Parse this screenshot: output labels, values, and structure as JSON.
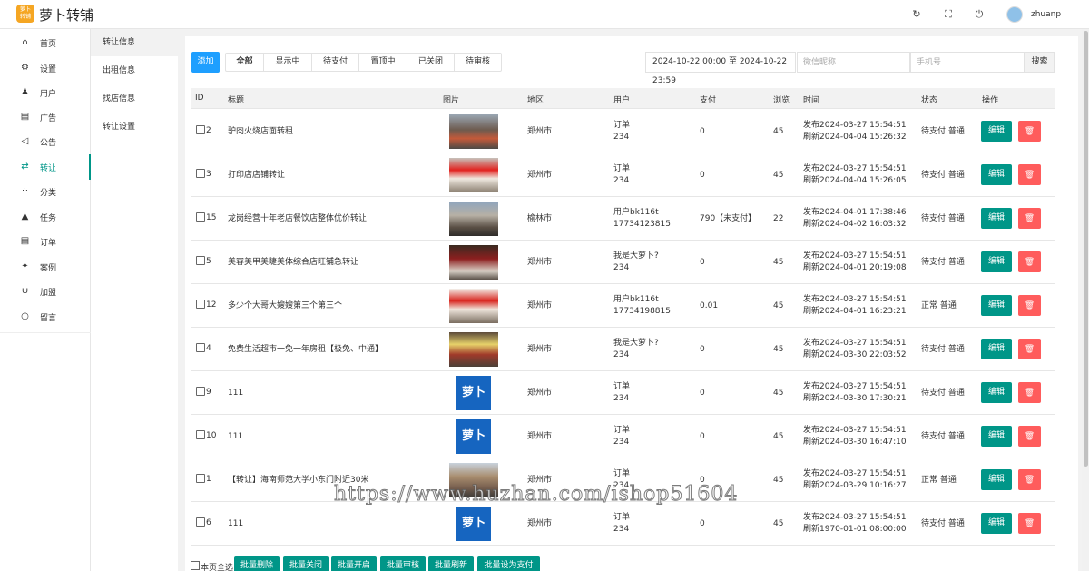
{
  "app": {
    "logo_text": "萝卜转铺",
    "title": "萝卜转铺"
  },
  "header": {
    "icons": [
      "refresh-icon",
      "fullscreen-icon",
      "power-icon"
    ],
    "username": "zhuanp"
  },
  "sidebar": {
    "items": [
      {
        "label": "首页",
        "icon": "home-icon"
      },
      {
        "label": "设置",
        "icon": "gear-icon"
      },
      {
        "label": "用户",
        "icon": "user-icon"
      },
      {
        "label": "广告",
        "icon": "document-icon"
      },
      {
        "label": "公告",
        "icon": "speaker-icon"
      },
      {
        "label": "转让",
        "icon": "shuffle-icon"
      },
      {
        "label": "分类",
        "icon": "category-icon"
      },
      {
        "label": "任务",
        "icon": "bell-icon"
      },
      {
        "label": "订单",
        "icon": "document-icon"
      },
      {
        "label": "案例",
        "icon": "medal-icon"
      },
      {
        "label": "加盟",
        "icon": "handshake-icon"
      },
      {
        "label": "留言",
        "icon": "chat-icon"
      }
    ],
    "active": "转让"
  },
  "subnav": {
    "items": [
      "转让信息",
      "出租信息",
      "找店信息",
      "转让设置"
    ],
    "active": "转让信息"
  },
  "toolbar": {
    "add_label": "添加",
    "filter_tabs": [
      "全部",
      "显示中",
      "待支付",
      "置顶中",
      "已关闭",
      "待审核"
    ],
    "active_tab": "全部",
    "date_range": "2024-10-22 00:00 至 2024-10-22 23:59",
    "nickname_placeholder": "微信昵称",
    "phone_placeholder": "手机号",
    "search_label": "搜索"
  },
  "table": {
    "columns": [
      "ID",
      "标题",
      "图片",
      "地区",
      "用户",
      "支付",
      "浏览",
      "时间",
      "状态",
      "操作"
    ],
    "edit_label": "编辑",
    "rows": [
      {
        "id": "2",
        "title": "驴肉火烧店面转租",
        "image": "photo",
        "region": "郑州市",
        "user1": "订单",
        "user2": "234",
        "pay": "0",
        "views": "45",
        "time1": "发布2024-03-27 15:54:51",
        "time2": "刷新2024-04-04 15:26:32",
        "status": "待支付 普通"
      },
      {
        "id": "3",
        "title": "打印店店铺转让",
        "image": "photo2",
        "region": "郑州市",
        "user1": "订单",
        "user2": "234",
        "pay": "0",
        "views": "45",
        "time1": "发布2024-03-27 15:54:51",
        "time2": "刷新2024-04-04 15:26:05",
        "status": "待支付 普通"
      },
      {
        "id": "15",
        "title": "龙岗经营十年老店餐饮店整体优价转让",
        "image": "photo3",
        "region": "榆林市",
        "user1": "用户bk116t",
        "user2": "17734123815",
        "pay": "790【未支付】",
        "views": "22",
        "time1": "发布2024-04-01 17:38:46",
        "time2": "刷新2024-04-02 16:03:32",
        "status": "待支付 普通"
      },
      {
        "id": "5",
        "title": "美容美甲美睫美体综合店旺铺急转让",
        "image": "photo4",
        "region": "郑州市",
        "user1": "我是大萝卜?",
        "user2": "234",
        "pay": "0",
        "views": "45",
        "time1": "发布2024-03-27 15:54:51",
        "time2": "刷新2024-04-01 20:19:08",
        "status": "待支付 普通"
      },
      {
        "id": "12",
        "title": "多少个大哥大嫂嫂第三个第三个",
        "image": "photo5",
        "region": "郑州市",
        "user1": "用户bk116t",
        "user2": "17734198815",
        "pay": "0.01",
        "views": "45",
        "time1": "发布2024-03-27 15:54:51",
        "time2": "刷新2024-04-01 16:23:21",
        "status": "正常 普通"
      },
      {
        "id": "4",
        "title": "免费生活超市一免一年房租【极免、中通】",
        "image": "photo6",
        "region": "郑州市",
        "user1": "我是大萝卜?",
        "user2": "234",
        "pay": "0",
        "views": "45",
        "time1": "发布2024-03-27 15:54:51",
        "time2": "刷新2024-03-30 22:03:52",
        "status": "待支付 普通"
      },
      {
        "id": "9",
        "title": "111",
        "image": "logo",
        "image_text": "萝卜",
        "region": "郑州市",
        "user1": "订单",
        "user2": "234",
        "pay": "0",
        "views": "45",
        "time1": "发布2024-03-27 15:54:51",
        "time2": "刷新2024-03-30 17:30:21",
        "status": "待支付 普通"
      },
      {
        "id": "10",
        "title": "111",
        "image": "logo",
        "image_text": "萝卜",
        "region": "郑州市",
        "user1": "订单",
        "user2": "234",
        "pay": "0",
        "views": "45",
        "time1": "发布2024-03-27 15:54:51",
        "time2": "刷新2024-03-30 16:47:10",
        "status": "待支付 普通"
      },
      {
        "id": "1",
        "title": "【转让】海南师范大学小东门附近30米",
        "image": "photo7",
        "region": "郑州市",
        "user1": "订单",
        "user2": "234",
        "pay": "0",
        "views": "45",
        "time1": "发布2024-03-27 15:54:51",
        "time2": "刷新2024-03-29 10:16:27",
        "status": "正常 普通"
      },
      {
        "id": "6",
        "title": "111",
        "image": "logo",
        "image_text": "萝卜",
        "region": "郑州市",
        "user1": "订单",
        "user2": "234",
        "pay": "0",
        "views": "45",
        "time1": "发布2024-03-27 15:54:51",
        "time2": "刷新1970-01-01 08:00:00",
        "status": "待支付 普通"
      }
    ]
  },
  "batch": {
    "select_all_label": "本页全选",
    "buttons": [
      "批量删除",
      "批量关闭",
      "批量开启",
      "批量审核",
      "批量刷新",
      "批量设为支付"
    ]
  },
  "watermark": "https://www.huzhan.com/ishop51604",
  "colors": {
    "primary": "#009688",
    "add": "#1e9fff",
    "danger": "#ff5c5c"
  }
}
